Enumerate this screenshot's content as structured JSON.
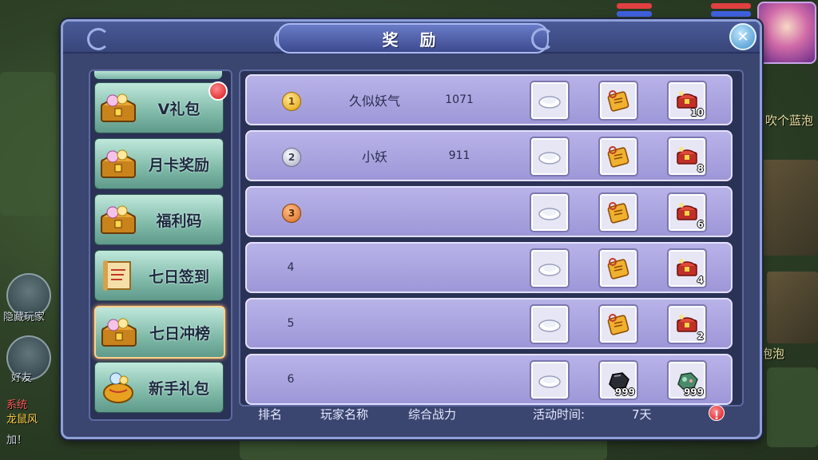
{
  "dialog": {
    "title": "奖 励",
    "close_symbol": "✕"
  },
  "background": {
    "chat_snippet_1": "吹个蓝泡",
    "chat_snippet_2": "泡泡",
    "hide_players_label": "隐藏玩家",
    "friends_label": "好友",
    "system_tag": "系统",
    "system_text": "龙鼠风",
    "add_text": "加！"
  },
  "sidebar": {
    "items": [
      {
        "label": "V礼包",
        "icon": "treasure-chest-icon",
        "has_notification": true
      },
      {
        "label": "月卡奖励",
        "icon": "treasure-chest-icon"
      },
      {
        "label": "福利码",
        "icon": "treasure-chest-icon"
      },
      {
        "label": "七日签到",
        "icon": "scroll-icon"
      },
      {
        "label": "七日冲榜",
        "icon": "treasure-chest-icon",
        "active": true
      },
      {
        "label": "新手礼包",
        "icon": "gift-bag-icon"
      }
    ]
  },
  "ranking": {
    "rows": [
      {
        "rank": "1",
        "medal": "gold",
        "player": "久似妖气",
        "power": "1071",
        "rewards": [
          {
            "icon": "white-cloud-item-icon",
            "qty": ""
          },
          {
            "icon": "gold-ticket-icon",
            "qty": ""
          },
          {
            "icon": "red-chest-item-icon",
            "qty": "10"
          }
        ]
      },
      {
        "rank": "2",
        "medal": "silver",
        "player": "小妖",
        "power": "911",
        "rewards": [
          {
            "icon": "white-cloud-item-icon",
            "qty": ""
          },
          {
            "icon": "gold-ticket-icon",
            "qty": ""
          },
          {
            "icon": "red-chest-item-icon",
            "qty": "8"
          }
        ]
      },
      {
        "rank": "3",
        "medal": "bronze",
        "player": "",
        "power": "",
        "rewards": [
          {
            "icon": "white-cloud-item-icon",
            "qty": ""
          },
          {
            "icon": "gold-ticket-icon",
            "qty": ""
          },
          {
            "icon": "red-chest-item-icon",
            "qty": "6"
          }
        ]
      },
      {
        "rank": "4",
        "medal": "",
        "player": "",
        "power": "",
        "rewards": [
          {
            "icon": "white-cloud-item-icon",
            "qty": ""
          },
          {
            "icon": "gold-ticket-icon",
            "qty": ""
          },
          {
            "icon": "red-chest-item-icon",
            "qty": "4"
          }
        ]
      },
      {
        "rank": "5",
        "medal": "",
        "player": "",
        "power": "",
        "rewards": [
          {
            "icon": "white-cloud-item-icon",
            "qty": ""
          },
          {
            "icon": "gold-ticket-icon",
            "qty": ""
          },
          {
            "icon": "red-chest-item-icon",
            "qty": "2"
          }
        ]
      },
      {
        "rank": "6",
        "medal": "",
        "player": "",
        "power": "",
        "rewards": [
          {
            "icon": "white-cloud-item-icon",
            "qty": ""
          },
          {
            "icon": "black-ore-icon",
            "qty": "999"
          },
          {
            "icon": "green-ore-icon",
            "qty": "999"
          }
        ]
      }
    ]
  },
  "footer": {
    "col_rank": "排名",
    "col_player": "玩家名称",
    "col_power": "综合战力",
    "time_label": "活动时间:",
    "time_value": "7天",
    "info_symbol": "!"
  },
  "colors": {
    "row_bg": "#a9a4e0",
    "panel": "#3a4670",
    "sidebar_item": "#8fc6b6"
  }
}
